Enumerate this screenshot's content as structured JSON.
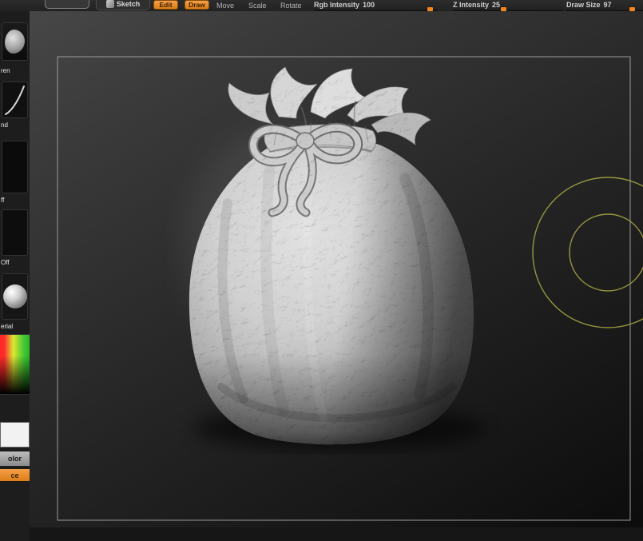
{
  "topbar": {
    "partial_button_label": "",
    "sketch": {
      "label": "Sketch"
    },
    "edit": {
      "label": "Edit"
    },
    "draw": {
      "label": "Draw"
    },
    "move": {
      "label": "Move"
    },
    "scale": {
      "label": "Scale"
    },
    "rotate": {
      "label": "Rotate"
    },
    "sliders": [
      {
        "label": "Rgb Intensity",
        "value": "100"
      },
      {
        "label": "Z Intensity",
        "value": "25"
      },
      {
        "label": "Draw Size",
        "value": "97"
      }
    ]
  },
  "sidebar": {
    "brush_label": "ren",
    "stroke_label": "nd",
    "alpha_label": "ff",
    "texture_label": "Off",
    "material_label": "erial",
    "switch_color_label": "olor",
    "bottom_button_label": "ce"
  },
  "colors": {
    "accent_orange": "#e8862a",
    "cursor_circle_yellow": "#9d9d42",
    "matcap_grey": "#c9c9c9"
  }
}
